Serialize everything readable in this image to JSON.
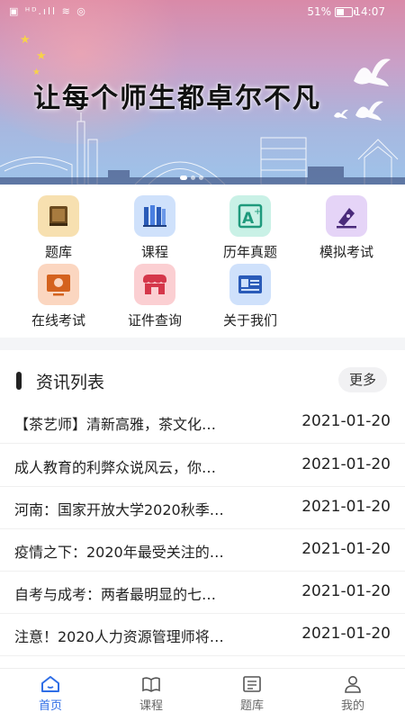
{
  "status_bar": {
    "battery": "51%",
    "time": "14:07"
  },
  "banner": {
    "slogan": "让每个师生都卓尔不凡"
  },
  "menu": [
    {
      "label": "题库",
      "icon": "book-icon",
      "color": "#f7e0b0"
    },
    {
      "label": "课程",
      "icon": "books-shelf-icon",
      "color": "#cfe1fb"
    },
    {
      "label": "历年真题",
      "icon": "a-plus-icon",
      "color": "#c9f1e6"
    },
    {
      "label": "模拟考试",
      "icon": "pen-icon",
      "color": "#e5d4f7"
    },
    {
      "label": "在线考试",
      "icon": "monitor-icon",
      "color": "#fbd6c0"
    },
    {
      "label": "证件查询",
      "icon": "store-icon",
      "color": "#fbcfd2"
    },
    {
      "label": "关于我们",
      "icon": "id-card-icon",
      "color": "#cfe1fb"
    }
  ],
  "news": {
    "title": "资讯列表",
    "more_label": "更多",
    "items": [
      {
        "title": "【茶艺师】清新高雅，茶文化…",
        "date": "2021-01-20"
      },
      {
        "title": "成人教育的利弊众说风云，你…",
        "date": "2021-01-20"
      },
      {
        "title": "河南：国家开放大学2020秋季…",
        "date": "2021-01-20"
      },
      {
        "title": "疫情之下：2020年最受关注的…",
        "date": "2021-01-20"
      },
      {
        "title": "自考与成考：两者最明显的七…",
        "date": "2021-01-20"
      },
      {
        "title": "注意！2020人力资源管理师将…",
        "date": "2021-01-20"
      }
    ]
  },
  "tabs": [
    {
      "label": "首页",
      "icon": "home-icon",
      "active": true
    },
    {
      "label": "课程",
      "icon": "open-book-icon",
      "active": false
    },
    {
      "label": "题库",
      "icon": "question-bank-icon",
      "active": false
    },
    {
      "label": "我的",
      "icon": "user-icon",
      "active": false
    }
  ],
  "colors": {
    "accent": "#2f6ee6"
  }
}
